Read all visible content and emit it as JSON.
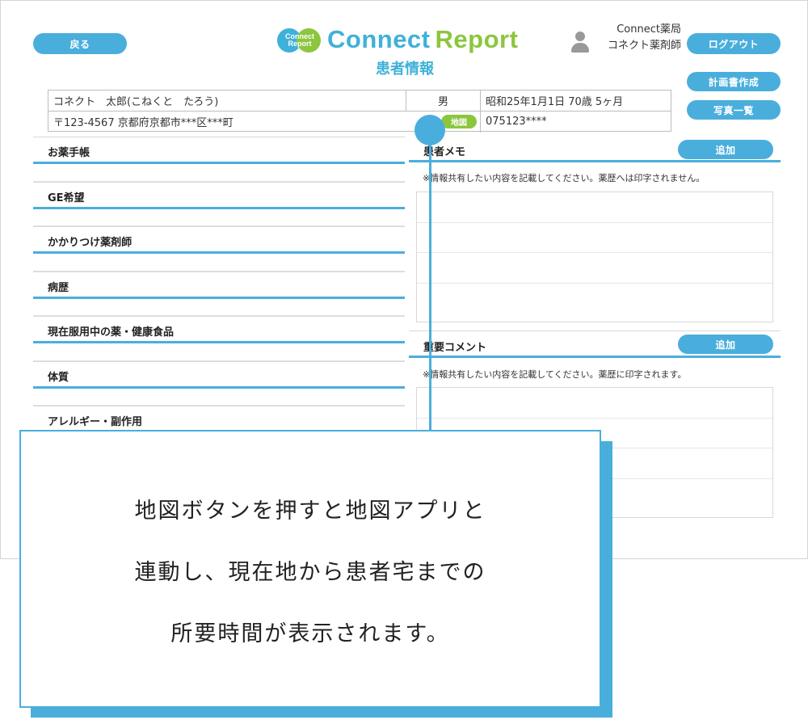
{
  "header": {
    "back_label": "戻る",
    "logo_mark_line1": "Connect",
    "logo_mark_line2": "Report",
    "logo_word1": "Connect",
    "logo_word2": "Report",
    "page_title": "患者情報",
    "user_store": "Connect薬局",
    "user_name": "コネクト薬剤師",
    "logout_label": "ログアウト",
    "plan_label": "計画書作成",
    "photos_label": "写真一覧"
  },
  "patient": {
    "name": "コネクト　太郎(こねくと　たろう)",
    "sex": "男",
    "birth_age": "昭和25年1月1日  70歳 5ヶ月",
    "address": "〒123-4567 京都府京都市***区***町",
    "map_label": "地図",
    "phone": "075123****"
  },
  "left_sections": [
    {
      "label": "お薬手帳"
    },
    {
      "label": "GE希望"
    },
    {
      "label": "かかりつけ薬剤師"
    },
    {
      "label": "病歴"
    },
    {
      "label": "現在服用中の薬・健康食品"
    },
    {
      "label": "体質"
    },
    {
      "label": "アレルギー・副作用"
    }
  ],
  "memo": {
    "title": "患者メモ",
    "add_label": "追加",
    "note": "※情報共有したい内容を記載してください。薬歴へは印字されません。"
  },
  "important": {
    "title": "重要コメント",
    "add_label": "追加",
    "note": "※情報共有したい内容を記載してください。薬歴に印字されます。"
  },
  "callout": {
    "line1": "地図ボタンを押すと地図アプリと",
    "line2": "連動し、現在地から患者宅までの",
    "line3": "所要時間が表示されます。"
  },
  "colors": {
    "accent_blue": "#4aaedc",
    "accent_green": "#8cc63f"
  }
}
